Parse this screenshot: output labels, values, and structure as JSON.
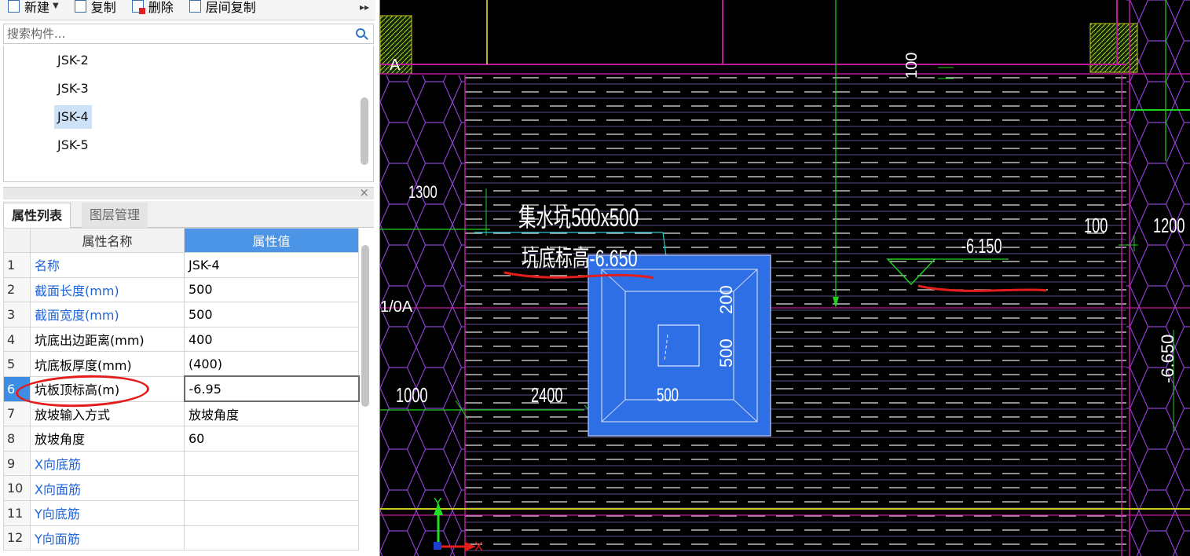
{
  "toolbar": {
    "new_label": "新建",
    "copy_label": "复制",
    "delete_label": "删除",
    "floor_copy_label": "层间复制",
    "more_glyph": "▸▸"
  },
  "search": {
    "placeholder": "搜索构件..."
  },
  "components": [
    "JSK-2",
    "JSK-3",
    "JSK-4",
    "JSK-5"
  ],
  "selected_component": "JSK-4",
  "panel_tabs": {
    "properties": "属性列表",
    "layers": "图层管理"
  },
  "close_glyph": "×",
  "properties": {
    "header_name": "属性名称",
    "header_value": "属性值",
    "rows": [
      {
        "n": "1",
        "name": "名称",
        "value": "JSK-4"
      },
      {
        "n": "2",
        "name": "截面长度(mm)",
        "value": "500"
      },
      {
        "n": "3",
        "name": "截面宽度(mm)",
        "value": "500"
      },
      {
        "n": "4",
        "name": "坑底出边距离(mm)",
        "value": "400"
      },
      {
        "n": "5",
        "name": "坑底板厚度(mm)",
        "value": "(400)"
      },
      {
        "n": "6",
        "name": "坑板顶标高(m)",
        "value": "-6.95"
      },
      {
        "n": "7",
        "name": "放坡输入方式",
        "value": "放坡角度"
      },
      {
        "n": "8",
        "name": "放坡角度",
        "value": "60"
      },
      {
        "n": "9",
        "name": "X向底筋",
        "value": ""
      },
      {
        "n": "10",
        "name": "X向面筋",
        "value": ""
      },
      {
        "n": "11",
        "name": "Y向底筋",
        "value": ""
      },
      {
        "n": "12",
        "name": "Y向面筋",
        "value": ""
      }
    ]
  },
  "cad": {
    "label_pit": "集水坑500x500",
    "label_elev": "坑底标高-6.650",
    "axis_a": "A",
    "axis_1_0a": "1/0A",
    "dim_1300": "1300",
    "dim_1000": "1000",
    "dim_2400": "2400",
    "dim_500_h": "500",
    "dim_500_v": "500",
    "dim_200": "200",
    "dim_100_top": "100",
    "dim_100_right": "100",
    "dim_1200": "1200",
    "elev_6150": "-6.150",
    "elev_6650_side": "-6.650",
    "ucs_y": "Y",
    "ucs_x": "X"
  },
  "colors": {
    "selection_blue": "#2f6fe6",
    "magenta": "#b0209e",
    "green": "#20d020",
    "hatch_yellow": "#c8c820",
    "annotation_red": "#e41c1c"
  }
}
